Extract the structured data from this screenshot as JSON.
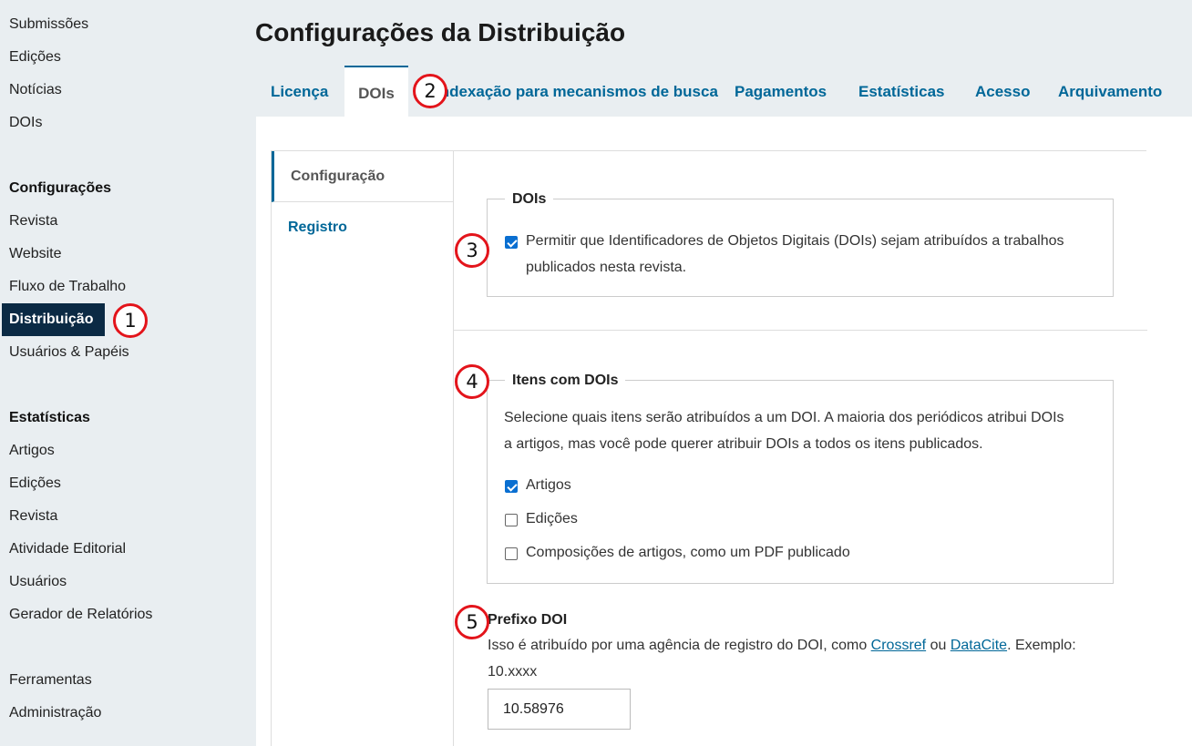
{
  "sidebar": {
    "items_top": [
      "Submissões",
      "Edições",
      "Notícias",
      "DOIs"
    ],
    "settings_heading": "Configurações",
    "settings_items": [
      "Revista",
      "Website",
      "Fluxo de Trabalho",
      "Distribuição",
      "Usuários & Papéis"
    ],
    "stats_heading": "Estatísticas",
    "stats_items": [
      "Artigos",
      "Edições",
      "Revista",
      "Atividade Editorial",
      "Usuários",
      "Gerador de Relatórios"
    ],
    "tools_items": [
      "Ferramentas",
      "Administração"
    ]
  },
  "page_title": "Configurações da Distribuição",
  "tabs": [
    "Licença",
    "DOIs",
    "Indexação para mecanismos de busca",
    "Pagamentos",
    "Estatísticas",
    "Acesso",
    "Arquivamento"
  ],
  "subnav": [
    "Configuração",
    "Registro"
  ],
  "dois_fieldset": {
    "legend": "DOIs",
    "checkbox_label_line1": "Permitir que Identificadores de Objetos Digitais (DOIs) sejam atribuídos a trabalhos",
    "checkbox_label_line2": "publicados nesta revista.",
    "checked": true
  },
  "items_fieldset": {
    "legend": "Itens com DOIs",
    "description_line1": "Selecione quais itens serão atribuídos a um DOI. A maioria dos periódicos atribui DOIs",
    "description_line2": "a artigos, mas você pode querer atribuir DOIs a todos os itens publicados.",
    "options": [
      {
        "label": "Artigos",
        "checked": true
      },
      {
        "label": "Edições",
        "checked": false
      },
      {
        "label": "Composições de artigos, como um PDF publicado",
        "checked": false
      }
    ]
  },
  "prefix": {
    "label": "Prefixo DOI",
    "help_before": "Isso é atribuído por uma agência de registro do DOI, como ",
    "link1": "Crossref",
    "help_mid": " ou ",
    "link2": "DataCite",
    "help_after": ". Exemplo:",
    "help_line2": "10.xxxx",
    "value": "10.58976"
  },
  "badges": [
    "1",
    "2",
    "3",
    "4",
    "5"
  ],
  "colors": {
    "accent": "#006798",
    "active_nav": "#0b2a44",
    "badge": "#e3141b"
  }
}
